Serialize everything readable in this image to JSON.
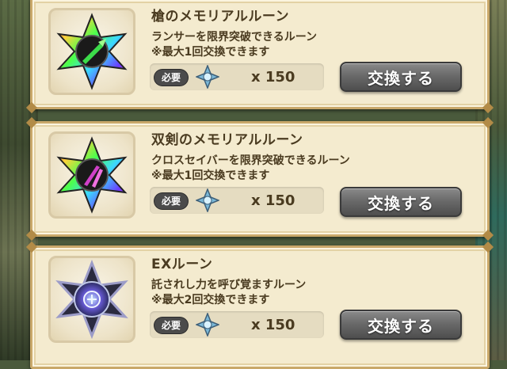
{
  "items": [
    {
      "name": "槍のメモリアルルーン",
      "desc1": "ランサーを限界突破できるルーン",
      "desc2": "※最大1回交換できます",
      "required_label": "必要",
      "count": "x 150",
      "button": "交換する",
      "icon": "lance-rune-icon"
    },
    {
      "name": "双剣のメモリアルルーン",
      "desc1": "クロスセイバーを限界突破できるルーン",
      "desc2": "※最大1回交換できます",
      "required_label": "必要",
      "count": "x 150",
      "button": "交換する",
      "icon": "twin-sword-rune-icon"
    },
    {
      "name": "EXルーン",
      "desc1": "託されし力を呼び覚ますルーン",
      "desc2": "※最大2回交換できます",
      "required_label": "必要",
      "count": "x 150",
      "button": "交換する",
      "icon": "ex-rune-icon"
    }
  ],
  "currency_icon": "crystal-currency-icon",
  "colors": {
    "card_bg": "#f4ebcf",
    "card_border": "#c9a86a",
    "text": "#4a3b20",
    "button": "#6a6a6a"
  }
}
